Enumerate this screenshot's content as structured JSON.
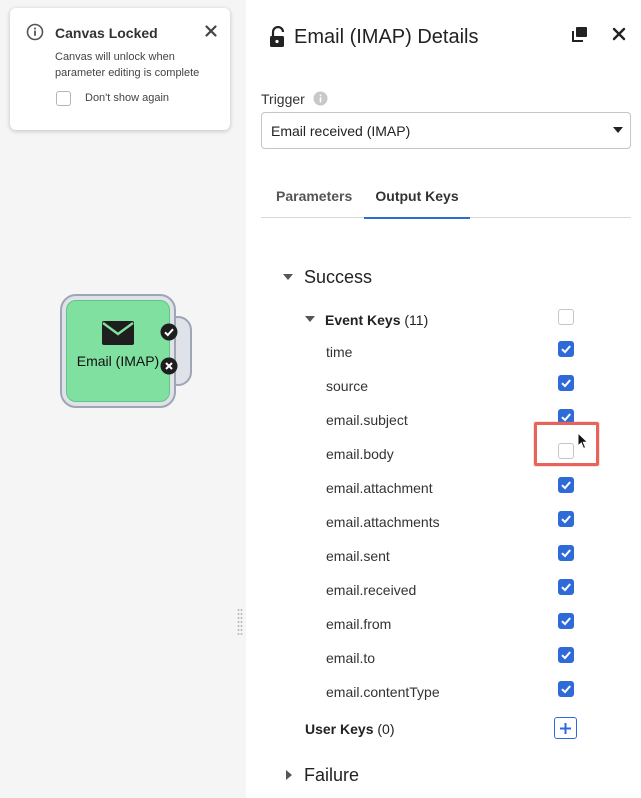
{
  "canvas_locked_toast": {
    "title": "Canvas Locked",
    "body": "Canvas will unlock when parameter editing is complete",
    "dont_show_label": "Don't show again",
    "dont_show_checked": false
  },
  "node": {
    "label": "Email (IMAP)",
    "icon": "envelope-icon",
    "color": "#7fe0a0"
  },
  "panel": {
    "title": "Email (IMAP) Details",
    "trigger_label": "Trigger",
    "trigger_value": "Email received (IMAP)",
    "tabs": [
      {
        "label": "Parameters",
        "active": false
      },
      {
        "label": "Output Keys",
        "active": true
      }
    ]
  },
  "output_keys": {
    "success_label": "Success",
    "event_keys_label": "Event Keys",
    "event_keys_count": "(11)",
    "event_keys_all_checked": false,
    "keys": [
      {
        "name": "time",
        "checked": true
      },
      {
        "name": "source",
        "checked": true
      },
      {
        "name": "email.subject",
        "checked": true
      },
      {
        "name": "email.body",
        "checked": false
      },
      {
        "name": "email.attachment",
        "checked": true
      },
      {
        "name": "email.attachments",
        "checked": true
      },
      {
        "name": "email.sent",
        "checked": true
      },
      {
        "name": "email.received",
        "checked": true
      },
      {
        "name": "email.from",
        "checked": true
      },
      {
        "name": "email.to",
        "checked": true
      },
      {
        "name": "email.contentType",
        "checked": true
      }
    ],
    "user_keys_label": "User Keys",
    "user_keys_count": "(0)",
    "failure_label": "Failure"
  },
  "colors": {
    "accent": "#2f6ad9",
    "highlight": "#e8645a"
  }
}
